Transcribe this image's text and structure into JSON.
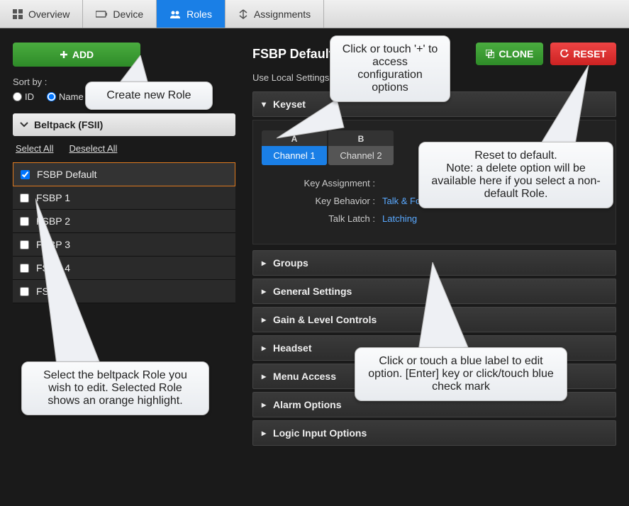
{
  "nav": {
    "overview": "Overview",
    "device": "Device",
    "roles": "Roles",
    "assignments": "Assignments"
  },
  "left": {
    "add": "ADD",
    "sort_label": "Sort by :",
    "sort_id": "ID",
    "sort_name": "Name",
    "acc_title": "Beltpack (FSII)",
    "select_all": "Select All",
    "deselect_all": "Deselect All",
    "roles": [
      {
        "label": "FSBP Default",
        "checked": true,
        "selected": true
      },
      {
        "label": "FSBP 1",
        "checked": false,
        "selected": false
      },
      {
        "label": "FSBP 2",
        "checked": false,
        "selected": false
      },
      {
        "label": "FSBP 3",
        "checked": false,
        "selected": false
      },
      {
        "label": "FSBP 4",
        "checked": false,
        "selected": false
      },
      {
        "label": "FSBP 5",
        "checked": false,
        "selected": false
      }
    ]
  },
  "right": {
    "title": "FSBP Default",
    "subtitle": "Use Local Settings",
    "clone": "CLONE",
    "reset": "RESET",
    "keyset": {
      "title": "Keyset",
      "tabs": [
        {
          "letter": "A",
          "label": "Channel 1",
          "active": true
        },
        {
          "letter": "B",
          "label": "Channel 2",
          "active": false
        }
      ],
      "rows": {
        "assignment_label": "Key Assignment :",
        "assignment_value": "",
        "behavior_label": "Key Behavior :",
        "behavior_value": "Talk & Force Listen",
        "latch_label": "Talk Latch :",
        "latch_value": "Latching"
      }
    },
    "sections": {
      "groups": "Groups",
      "general": "General Settings",
      "gain": "Gain & Level Controls",
      "headset": "Headset",
      "menu": "Menu Access",
      "alarm": "Alarm Options",
      "logic": "Logic Input Options"
    }
  },
  "callouts": {
    "c1": "Create new Role",
    "c2": "Select the beltpack Role you wish to edit. Selected Role shows an orange highlight.",
    "c3": "Click or touch '+' to access configuration options",
    "c4": "Reset to default.\nNote: a delete option will be available here if you select a non-default Role.",
    "c5": "Click or touch a blue label to edit option. [Enter] key or click/touch blue check mark"
  }
}
